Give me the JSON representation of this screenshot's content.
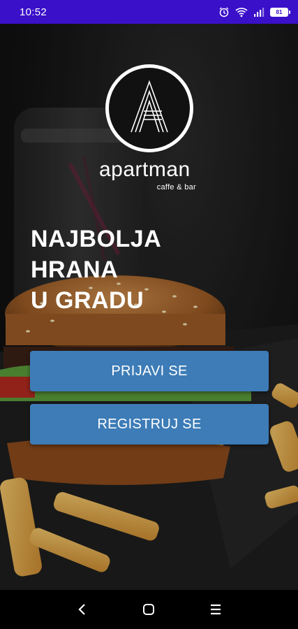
{
  "status_bar": {
    "time": "10:52",
    "battery_level": "81",
    "icons": [
      "alarm-icon",
      "wifi-icon",
      "signal-icon",
      "battery-icon"
    ]
  },
  "brand": {
    "name": "apartman",
    "tagline": "caffe & bar",
    "logo_letter": "A"
  },
  "headline": {
    "line1": "NAJBOLJA",
    "line2": "HRANA",
    "line3": "U GRADU"
  },
  "buttons": {
    "login_label": "PRIJAVI SE",
    "register_label": "REGISTRUJ SE"
  },
  "nav_bar": {
    "icons": [
      "back-icon",
      "home-icon",
      "menu-icon"
    ]
  },
  "colors": {
    "status_bar": "#3a10c9",
    "button": "#3d7cb7",
    "text": "#ffffff"
  }
}
